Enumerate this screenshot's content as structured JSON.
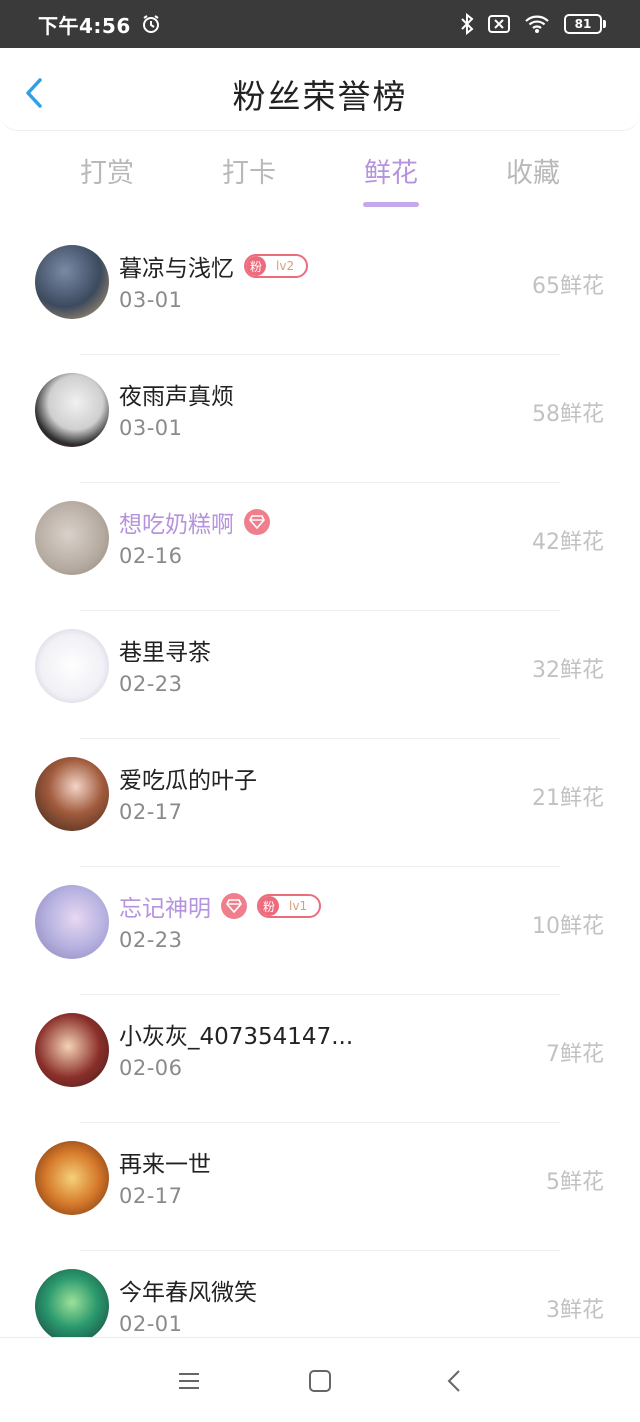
{
  "status_bar": {
    "time": "下午4:56",
    "battery": "81",
    "icons": [
      "alarm-icon",
      "bluetooth-icon",
      "sim-disabled-icon",
      "wifi-icon",
      "battery-icon"
    ]
  },
  "header": {
    "title": "粉丝荣誉榜",
    "back_icon": "chevron-left-icon"
  },
  "tabs": [
    {
      "label": "打赏",
      "active": false
    },
    {
      "label": "打卡",
      "active": false
    },
    {
      "label": "鲜花",
      "active": true
    },
    {
      "label": "收藏",
      "active": false
    }
  ],
  "fans": [
    {
      "name": "暮凉与浅忆",
      "date": "03-01",
      "count": "65鲜花",
      "vip": false,
      "gem": false,
      "fan_badge": {
        "label": "粉",
        "level": "lv2"
      }
    },
    {
      "name": "夜雨声真烦",
      "date": "03-01",
      "count": "58鲜花",
      "vip": false,
      "gem": false,
      "fan_badge": null
    },
    {
      "name": "想吃奶糕啊",
      "date": "02-16",
      "count": "42鲜花",
      "vip": true,
      "gem": true,
      "fan_badge": null
    },
    {
      "name": "巷里寻茶",
      "date": "02-23",
      "count": "32鲜花",
      "vip": false,
      "gem": false,
      "fan_badge": null
    },
    {
      "name": "爱吃瓜的叶子",
      "date": "02-17",
      "count": "21鲜花",
      "vip": false,
      "gem": false,
      "fan_badge": null
    },
    {
      "name": "忘记神明",
      "date": "02-23",
      "count": "10鲜花",
      "vip": true,
      "gem": true,
      "fan_badge": {
        "label": "粉",
        "level": "lv1"
      }
    },
    {
      "name": "小灰灰_407354147...",
      "date": "02-06",
      "count": "7鲜花",
      "vip": false,
      "gem": false,
      "fan_badge": null
    },
    {
      "name": "再来一世",
      "date": "02-17",
      "count": "5鲜花",
      "vip": false,
      "gem": false,
      "fan_badge": null
    },
    {
      "name": "今年春风微笑",
      "date": "02-01",
      "count": "3鲜花",
      "vip": false,
      "gem": false,
      "fan_badge": null
    }
  ],
  "nav_bar": {
    "icons": [
      "menu-icon",
      "home-square-icon",
      "back-triangle-icon"
    ]
  },
  "colors": {
    "accent": "#b594dd",
    "badge": "#ec6c7e",
    "status_bar": "#3a3a3a"
  }
}
